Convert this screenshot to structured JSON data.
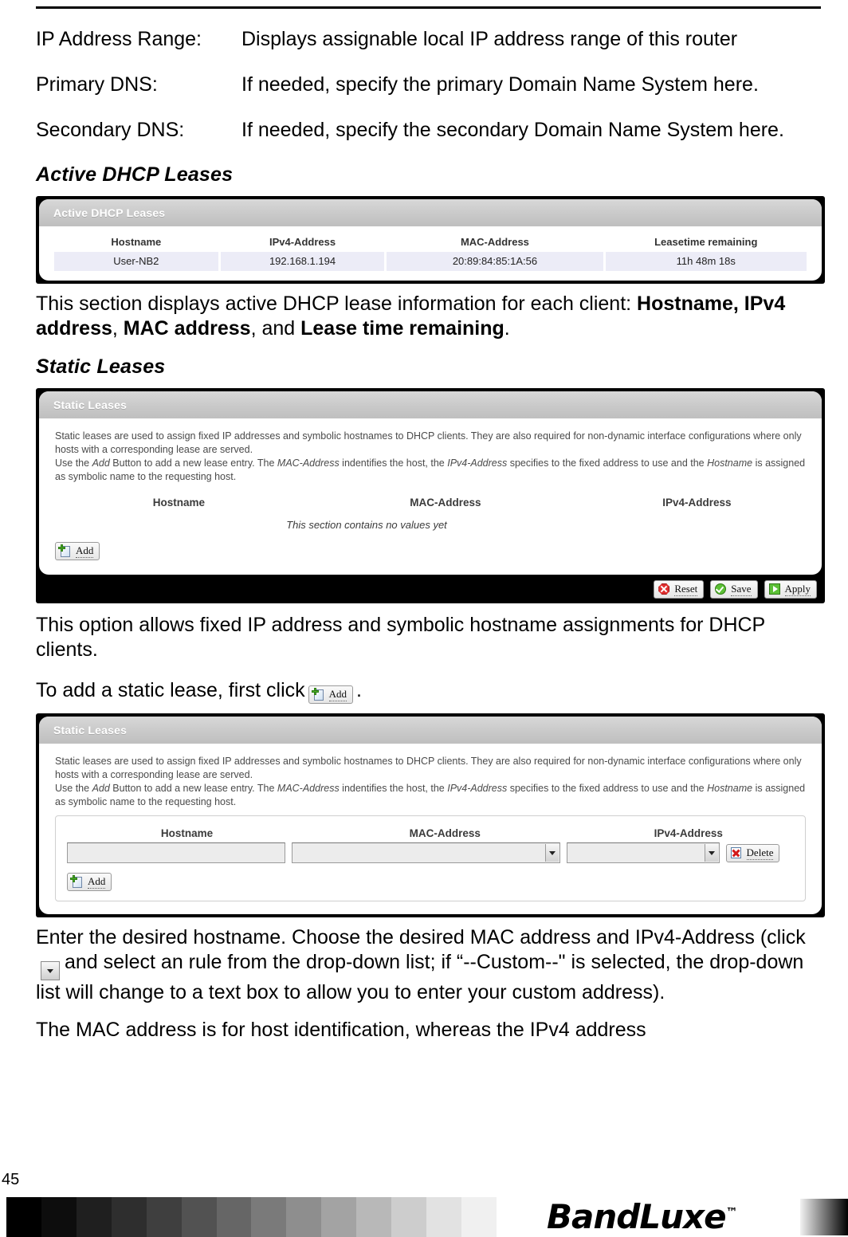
{
  "definitions": [
    {
      "term": "IP Address Range:",
      "desc": "Displays assignable local IP address range of this router"
    },
    {
      "term": "Primary DNS:",
      "desc": "If needed, specify the primary Domain Name System here."
    },
    {
      "term": "Secondary DNS:",
      "desc": "If needed, specify the secondary Domain Name System here."
    }
  ],
  "active_dhcp": {
    "heading": "Active DHCP Leases",
    "panel_title": "Active DHCP Leases",
    "columns": [
      "Hostname",
      "IPv4-Address",
      "MAC-Address",
      "Leasetime remaining"
    ],
    "rows": [
      [
        "User-NB2",
        "192.168.1.194",
        "20:89:84:85:1A:56",
        "11h 48m 18s"
      ]
    ],
    "caption_lead": "This section displays active DHCP lease information for each client: ",
    "caption_b1": "Hostname, IPv4 address",
    "caption_sep1": ", ",
    "caption_b2": "MAC address",
    "caption_sep2": ", and ",
    "caption_b3": "Lease time remaining",
    "caption_end": "."
  },
  "static_leases": {
    "heading": "Static Leases",
    "panel_title": "Static Leases",
    "desc_p1": "Static leases are used to assign fixed IP addresses and symbolic hostnames to DHCP clients. They are also required for non-dynamic interface configurations where only hosts with a corresponding lease are served.",
    "desc_p2_a": "Use the ",
    "desc_p2_add": "Add",
    "desc_p2_b": " Button to add a new lease entry. The ",
    "desc_p2_mac": "MAC-Address",
    "desc_p2_c": " indentifies the host, the ",
    "desc_p2_ipv4": "IPv4-Address",
    "desc_p2_d": " specifies to the fixed address to use and the ",
    "desc_p2_host": "Hostname",
    "desc_p2_e": " is assigned as symbolic name to the requesting host.",
    "columns": [
      "Hostname",
      "MAC-Address",
      "IPv4-Address"
    ],
    "empty_note": "This section contains no values yet",
    "add_label": "Add",
    "delete_label": "Delete",
    "reset_label": "Reset",
    "save_label": "Save",
    "apply_label": "Apply",
    "hostname_value": "",
    "mac_value": "",
    "ipv4_value": "",
    "para_option": "This option allows fixed IP address and symbolic hostname assignments for DHCP clients.",
    "para_toadd_a": "To add a static lease, first click",
    "para_toadd_b": ".",
    "para_enter_a": "Enter the desired hostname. Choose the desired MAC address and IPv4-Address (click",
    "para_enter_b": "and select an rule from the drop-down list; if “--Custom--\" is selected, the drop-down list will change to a text box to allow you to enter your custom address).",
    "para_mac": "The MAC address is for host identification, whereas the IPv4 address"
  },
  "footer": {
    "page_number": "45",
    "brand": "BandLuxe",
    "trademark": "™",
    "gray_steps": [
      "#000000",
      "#0d0d0d",
      "#1f1f1f",
      "#2e2e2e",
      "#3f3f3f",
      "#525252",
      "#666666",
      "#7a7a7a",
      "#8e8e8e",
      "#a3a3a3",
      "#b8b8b8",
      "#cdcdcd",
      "#e2e2e2",
      "#f0f0f0"
    ]
  }
}
